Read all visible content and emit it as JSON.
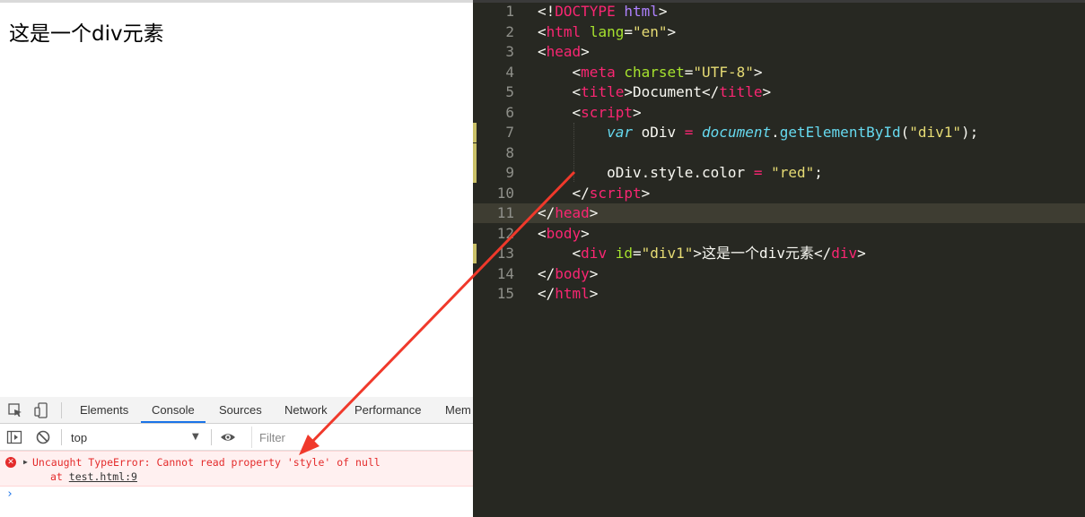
{
  "browser": {
    "page_text": "这是一个div元素"
  },
  "devtools": {
    "tabs": [
      "Elements",
      "Console",
      "Sources",
      "Network",
      "Performance",
      "Mem"
    ],
    "active_tab": "Console",
    "context_value": "top",
    "filter_placeholder": "Filter",
    "error": {
      "message": "Uncaught TypeError: Cannot read property 'style' of null",
      "at_prefix": "at ",
      "location": "test.html:9"
    },
    "prompt": "›",
    "colors": {
      "error": "#e42b2b",
      "active_tab": "#1a73e8"
    }
  },
  "editor": {
    "theme_colors": {
      "background": "#272822",
      "tag": "#f92672",
      "attr": "#a6e22e",
      "string": "#e6db74",
      "keyword": "#66d9ef"
    },
    "current_line": 11,
    "modified_lines": [
      7,
      8,
      9,
      13
    ],
    "lines": [
      {
        "n": "1",
        "tokens": [
          [
            "<!",
            "t-txt"
          ],
          [
            "DOCTYPE",
            "t-tag"
          ],
          [
            " ",
            "t-txt"
          ],
          [
            "html",
            "t-doc"
          ],
          [
            ">",
            "t-txt"
          ]
        ]
      },
      {
        "n": "2",
        "tokens": [
          [
            "<",
            "t-txt"
          ],
          [
            "html",
            "t-tag"
          ],
          [
            " ",
            "t-txt"
          ],
          [
            "lang",
            "t-attr"
          ],
          [
            "=",
            "t-txt"
          ],
          [
            "\"en\"",
            "t-str"
          ],
          [
            ">",
            "t-txt"
          ]
        ]
      },
      {
        "n": "3",
        "tokens": [
          [
            "<",
            "t-txt"
          ],
          [
            "head",
            "t-tag"
          ],
          [
            ">",
            "t-txt"
          ]
        ]
      },
      {
        "n": "4",
        "tokens": [
          [
            "    <",
            "t-txt"
          ],
          [
            "meta",
            "t-tag"
          ],
          [
            " ",
            "t-txt"
          ],
          [
            "charset",
            "t-attr"
          ],
          [
            "=",
            "t-txt"
          ],
          [
            "\"UTF-8\"",
            "t-str"
          ],
          [
            ">",
            "t-txt"
          ]
        ]
      },
      {
        "n": "5",
        "tokens": [
          [
            "    <",
            "t-txt"
          ],
          [
            "title",
            "t-tag"
          ],
          [
            ">Document</",
            "t-txt"
          ],
          [
            "title",
            "t-tag"
          ],
          [
            ">",
            "t-txt"
          ]
        ]
      },
      {
        "n": "6",
        "tokens": [
          [
            "    <",
            "t-txt"
          ],
          [
            "script",
            "t-tag"
          ],
          [
            ">",
            "t-txt"
          ]
        ]
      },
      {
        "n": "7",
        "tokens": [
          [
            "        ",
            "t-txt"
          ],
          [
            "var",
            "t-kw"
          ],
          [
            " oDiv ",
            "t-txt"
          ],
          [
            "=",
            "t-op"
          ],
          [
            " ",
            "t-txt"
          ],
          [
            "document",
            "t-kw"
          ],
          [
            ".",
            "t-txt"
          ],
          [
            "getElementById",
            "t-fn"
          ],
          [
            "(",
            "t-txt"
          ],
          [
            "\"div1\"",
            "t-str"
          ],
          [
            ");",
            "t-txt"
          ]
        ]
      },
      {
        "n": "8",
        "tokens": []
      },
      {
        "n": "9",
        "tokens": [
          [
            "        oDiv.style.color ",
            "t-txt"
          ],
          [
            "=",
            "t-op"
          ],
          [
            " ",
            "t-txt"
          ],
          [
            "\"red\"",
            "t-str"
          ],
          [
            ";",
            "t-txt"
          ]
        ]
      },
      {
        "n": "10",
        "tokens": [
          [
            "    </",
            "t-txt"
          ],
          [
            "script",
            "t-tag"
          ],
          [
            ">",
            "t-txt"
          ]
        ]
      },
      {
        "n": "11",
        "tokens": [
          [
            "</",
            "t-txt"
          ],
          [
            "head",
            "t-tag"
          ],
          [
            ">",
            "t-txt"
          ]
        ]
      },
      {
        "n": "12",
        "tokens": [
          [
            "<",
            "t-txt"
          ],
          [
            "body",
            "t-tag"
          ],
          [
            ">",
            "t-txt"
          ]
        ]
      },
      {
        "n": "13",
        "tokens": [
          [
            "    <",
            "t-txt"
          ],
          [
            "div",
            "t-tag"
          ],
          [
            " ",
            "t-txt"
          ],
          [
            "id",
            "t-attr"
          ],
          [
            "=",
            "t-txt"
          ],
          [
            "\"div1\"",
            "t-str"
          ],
          [
            ">这是一个div元素</",
            "t-txt"
          ],
          [
            "div",
            "t-tag"
          ],
          [
            ">",
            "t-txt"
          ]
        ]
      },
      {
        "n": "14",
        "tokens": [
          [
            "</",
            "t-txt"
          ],
          [
            "body",
            "t-tag"
          ],
          [
            ">",
            "t-txt"
          ]
        ]
      },
      {
        "n": "15",
        "tokens": [
          [
            "</",
            "t-txt"
          ],
          [
            "html",
            "t-tag"
          ],
          [
            ">",
            "t-txt"
          ]
        ]
      }
    ]
  }
}
